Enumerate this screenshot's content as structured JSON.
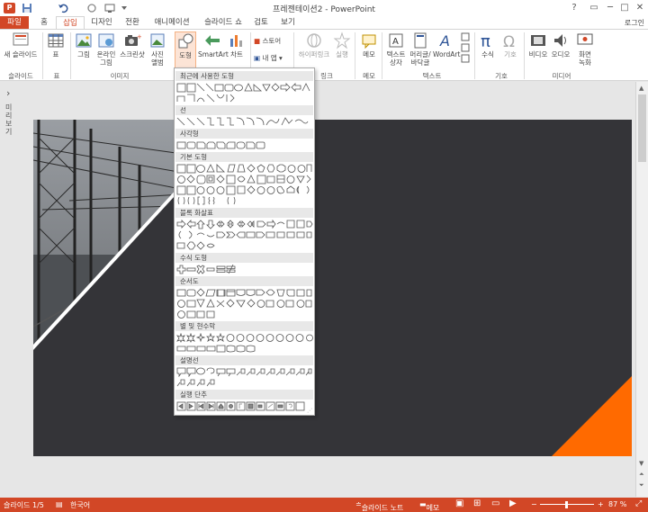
{
  "window": {
    "title": "프레젠테이션2 - PowerPoint",
    "app_logo": "P",
    "help": "?",
    "minimize": "─",
    "maximize": "□",
    "close": "✕"
  },
  "qat": [
    "save-icon",
    "undo-icon",
    "redo-icon",
    "start-from-beginning-icon",
    "customize-icon"
  ],
  "tabs": {
    "file": "파일",
    "home": "홈",
    "insert": "삽입",
    "design": "디자인",
    "transitions": "전환",
    "animations": "애니메이션",
    "slideshow": "슬라이드 쇼",
    "review": "검토",
    "view": "보기",
    "signin": "로그인"
  },
  "ribbon": {
    "new_slide": "새 슬라이드",
    "table": "표",
    "picture": "그림",
    "online_picture_1": "온라인",
    "online_picture_2": "그림",
    "screenshot": "스크린샷",
    "photo_album_1": "사진",
    "photo_album_2": "앨범",
    "shapes": "도형",
    "smartart": "SmartArt",
    "chart": "차트",
    "store": "스토어",
    "my_apps": "내 앱",
    "hyperlink": "하이퍼링크",
    "action": "실행",
    "comment": "메모",
    "textbox_1": "텍스트",
    "textbox_2": "상자",
    "header_footer_1": "머리글/",
    "header_footer_2": "바닥글",
    "wordart": "WordArt",
    "equation": "수식",
    "symbol": "기호",
    "video": "비디오",
    "audio": "오디오",
    "screen_recording_1": "화면",
    "screen_recording_2": "녹화",
    "groups": {
      "slides": "슬라이드",
      "tables": "표",
      "images": "이미지",
      "links": "링크",
      "comments": "메모",
      "text": "텍스트",
      "symbols": "기호",
      "media": "미디어"
    }
  },
  "shapes_menu": {
    "categories": [
      "최근에 사용한 도형",
      "선",
      "사각형",
      "기본 도형",
      "블록 화살표",
      "수식 도형",
      "순서도",
      "별 및 현수막",
      "설명선",
      "실행 단추"
    ]
  },
  "left_pane": {
    "collapse_arrow": "›",
    "label": "미리 보기"
  },
  "statusbar": {
    "slide": "슬라이드 1/5",
    "language": "한국어",
    "notes": "슬라이드 노트",
    "comments": "메모",
    "zoom": "87 %"
  },
  "colors": {
    "accent": "#d24726",
    "slide_bg": "#343438",
    "slide_corner": "#ff6a00"
  }
}
